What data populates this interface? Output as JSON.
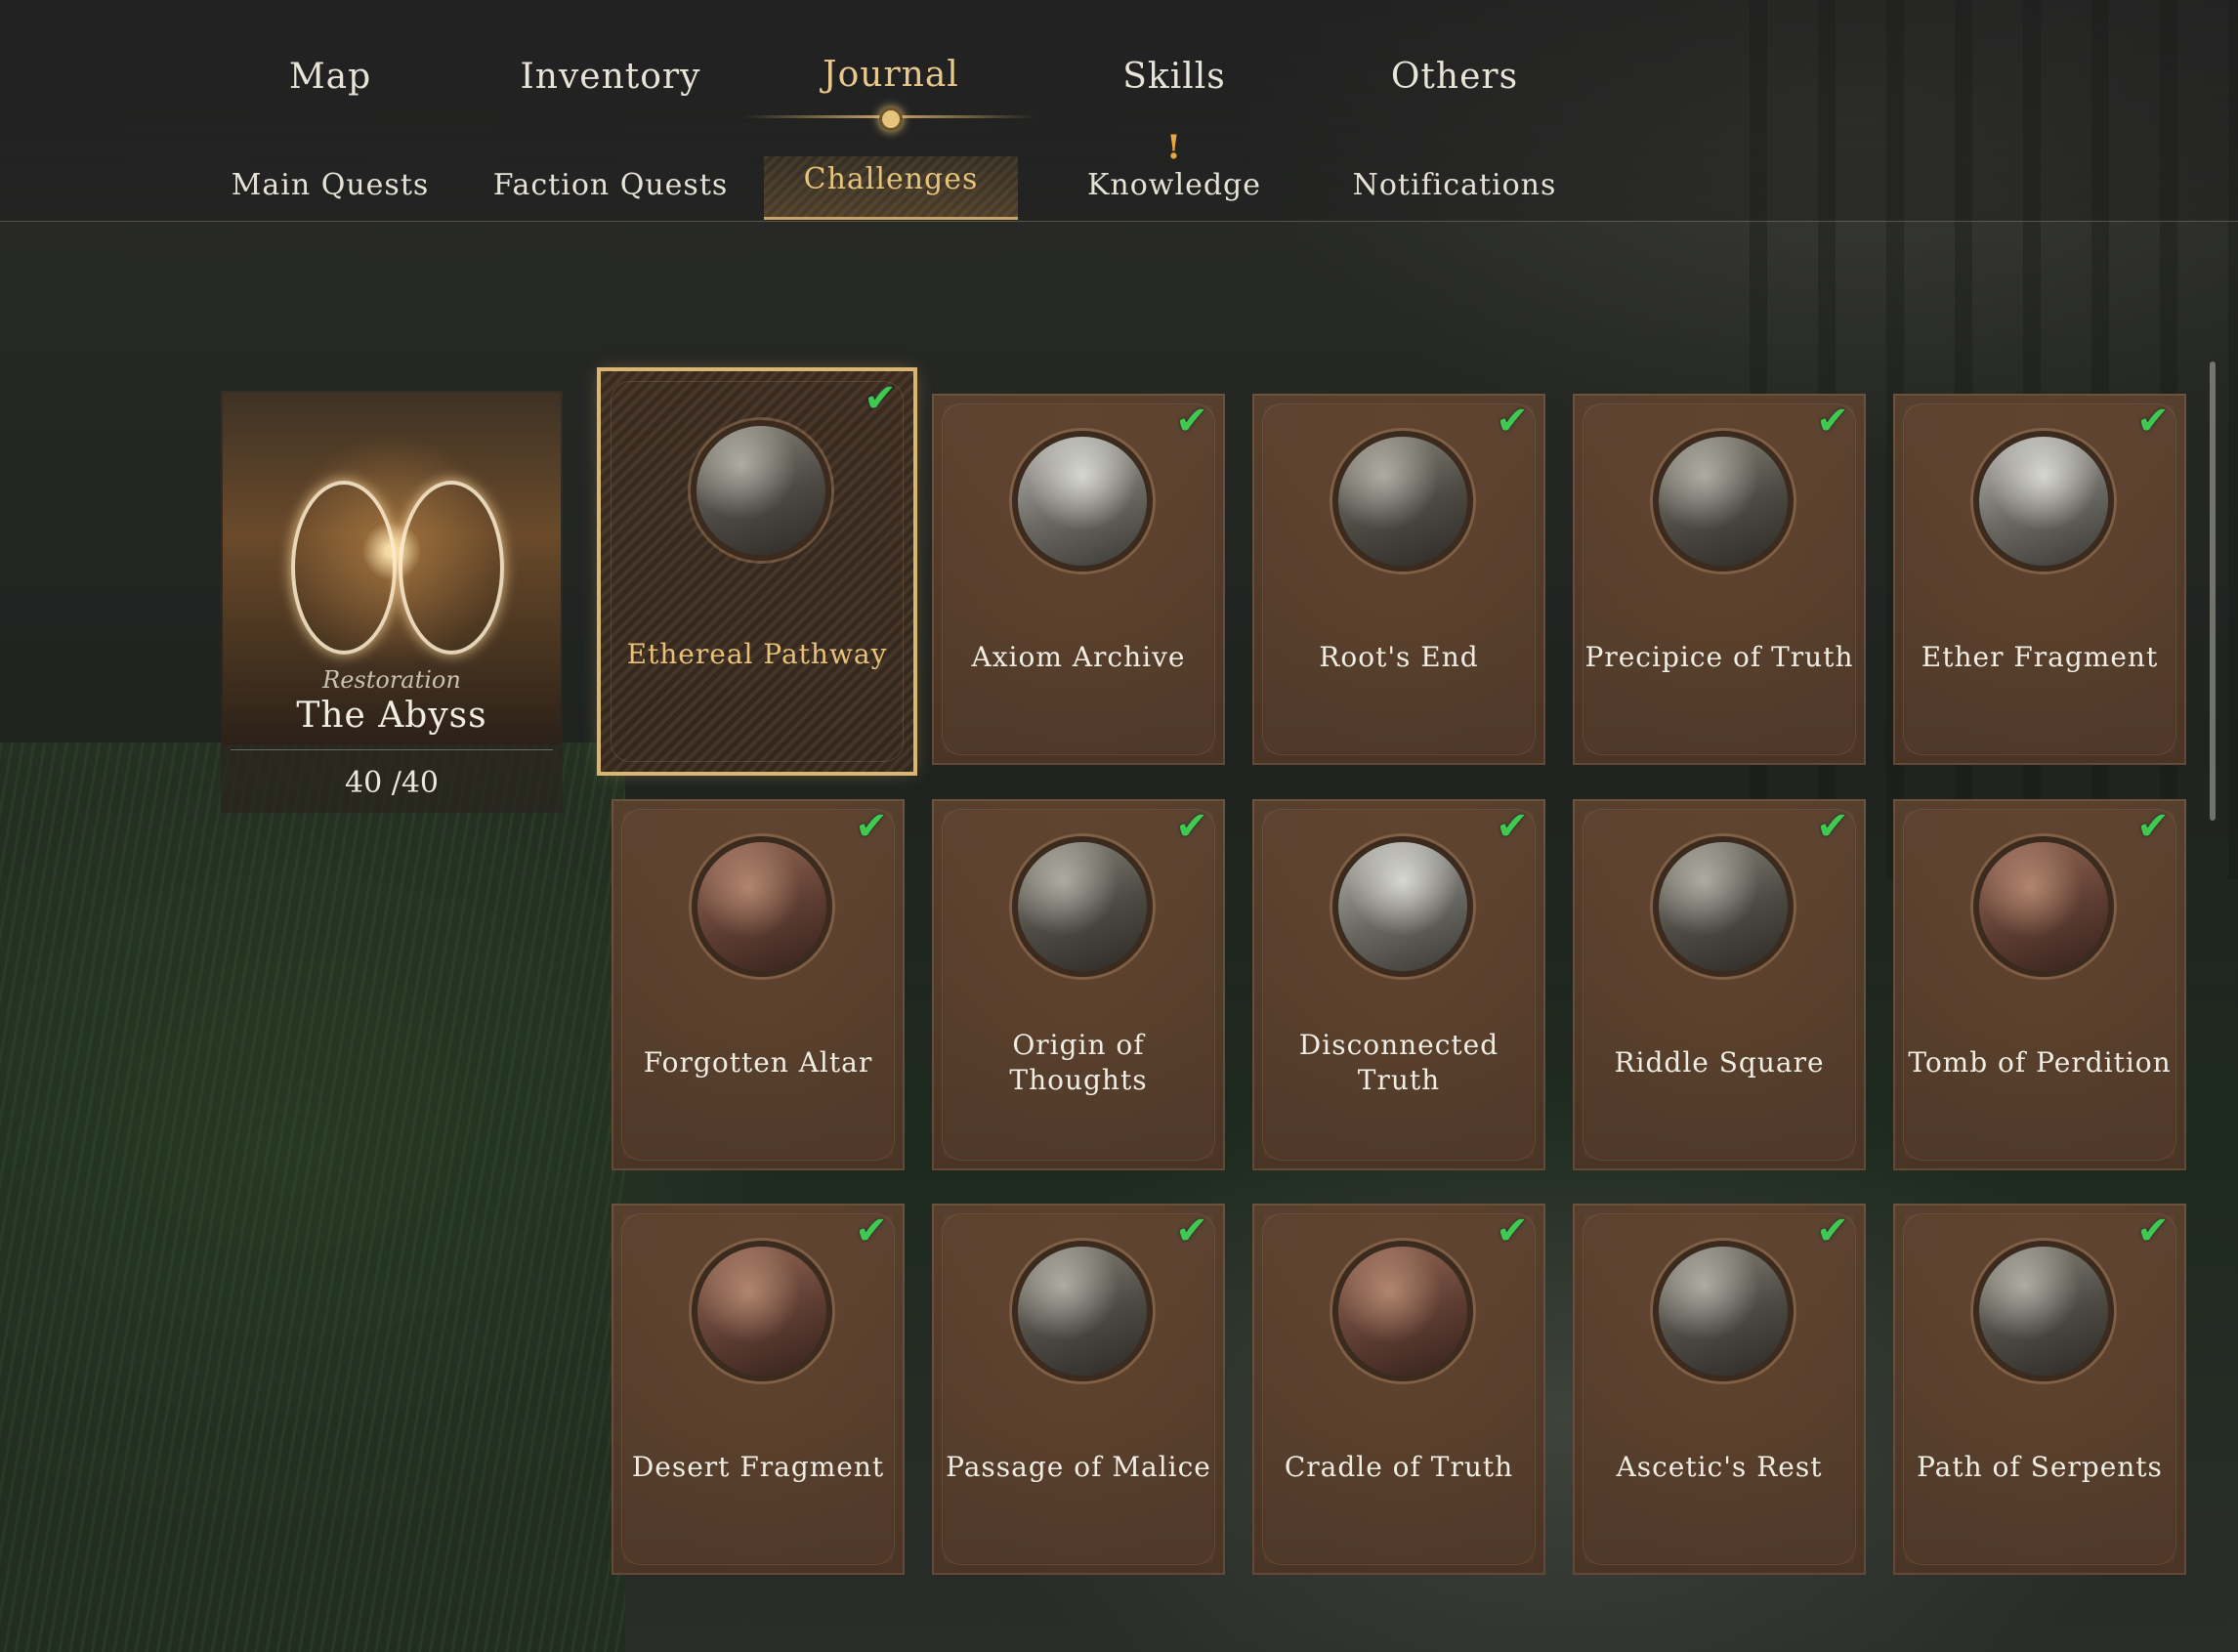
{
  "nav": {
    "tabs": [
      {
        "label": "Map"
      },
      {
        "label": "Inventory"
      },
      {
        "label": "Journal"
      },
      {
        "label": "Skills"
      },
      {
        "label": "Others"
      }
    ],
    "active_tab": "Journal",
    "subtabs": [
      {
        "label": "Main Quests"
      },
      {
        "label": "Faction Quests"
      },
      {
        "label": "Challenges"
      },
      {
        "label": "Knowledge",
        "alert": "!"
      },
      {
        "label": "Notifications"
      }
    ],
    "active_subtab": "Challenges"
  },
  "region": {
    "subtitle": "Restoration",
    "name": "The Abyss",
    "progress": "40 /40"
  },
  "challenges": [
    {
      "label": "Ethereal Pathway",
      "completed": true,
      "selected": true
    },
    {
      "label": "Axiom Archive",
      "completed": true
    },
    {
      "label": "Root's End",
      "completed": true
    },
    {
      "label": "Precipice of Truth",
      "completed": true
    },
    {
      "label": "Ether Fragment",
      "completed": true
    },
    {
      "label": "Forgotten Altar",
      "completed": true
    },
    {
      "label": "Origin of Thoughts",
      "completed": true
    },
    {
      "label": "Disconnected Truth",
      "completed": true
    },
    {
      "label": "Riddle Square",
      "completed": true
    },
    {
      "label": "Tomb of Perdition",
      "completed": true
    },
    {
      "label": "Desert Fragment",
      "completed": true
    },
    {
      "label": "Passage of Malice",
      "completed": true
    },
    {
      "label": "Cradle of Truth",
      "completed": true
    },
    {
      "label": "Ascetic's Rest",
      "completed": true
    },
    {
      "label": "Path of Serpents",
      "completed": true
    }
  ],
  "check_glyph": "✔",
  "colors": {
    "accent_gold": "#e7c47b",
    "check_green": "#3fc94f",
    "card_brown": "#5d4330",
    "alert_orange": "#e8a83a"
  }
}
